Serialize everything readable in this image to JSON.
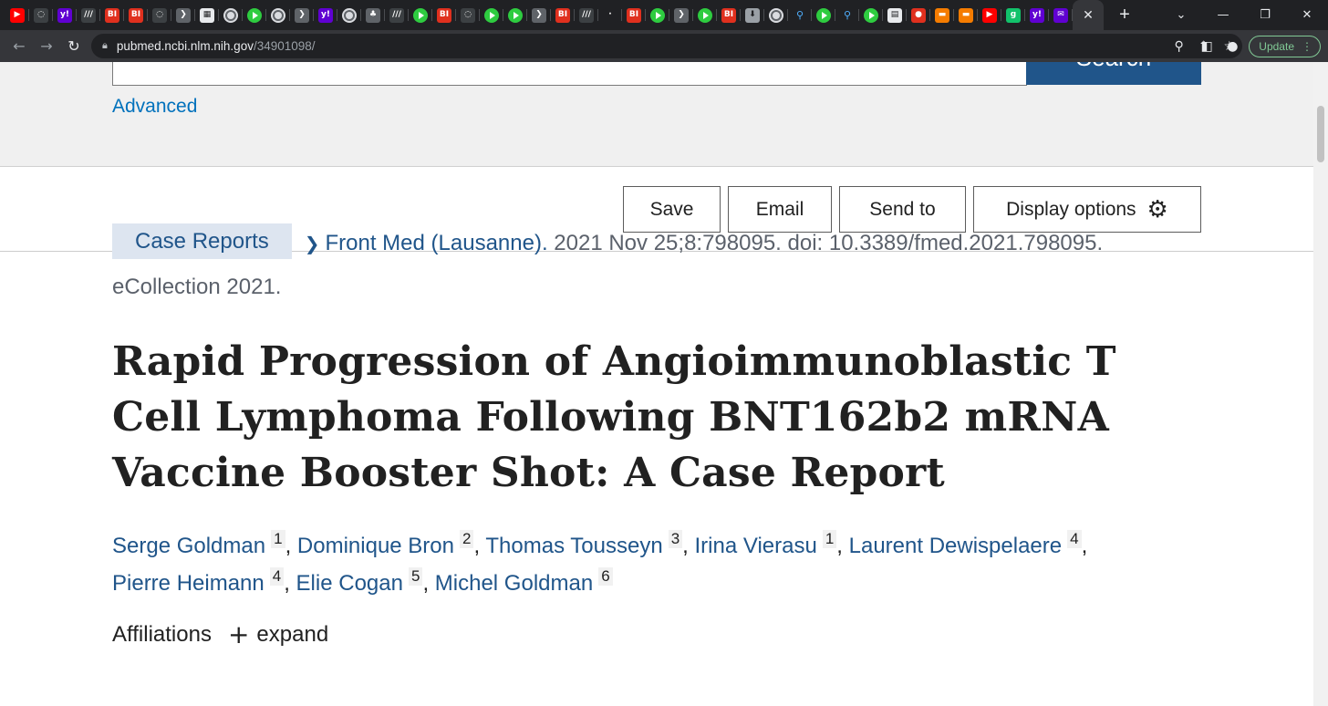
{
  "browser": {
    "tab_icons": [
      {
        "name": "youtube-icon",
        "bg": "#ff0000",
        "glyph": "▶"
      },
      {
        "name": "shield-icon",
        "bg": "#3c4043",
        "glyph": "◌"
      },
      {
        "name": "yahoo-icon",
        "bg": "#6001d2",
        "glyph": "y!"
      },
      {
        "name": "slash-icon",
        "bg": "#3c4043",
        "glyph": "///"
      },
      {
        "name": "bi-icon",
        "bg": "#e0301e",
        "glyph": "BI"
      },
      {
        "name": "bi-icon",
        "bg": "#e0301e",
        "glyph": "BI"
      },
      {
        "name": "shield-icon",
        "bg": "#3c4043",
        "glyph": "◌"
      },
      {
        "name": "forward-icon",
        "bg": "#5f6368",
        "glyph": "❯"
      },
      {
        "name": "grid-icon",
        "bg": "#e8eaed",
        "glyph": "▦"
      },
      {
        "name": "globe-icon",
        "bg": "globe",
        "glyph": ""
      },
      {
        "name": "play-icon",
        "bg": "play",
        "glyph": ""
      },
      {
        "name": "globe-icon",
        "bg": "globe",
        "glyph": ""
      },
      {
        "name": "forward-icon",
        "bg": "#5f6368",
        "glyph": "❯"
      },
      {
        "name": "yahoo-icon",
        "bg": "#6001d2",
        "glyph": "y!"
      },
      {
        "name": "globe-icon",
        "bg": "globe",
        "glyph": ""
      },
      {
        "name": "tree-icon",
        "bg": "#5f6368",
        "glyph": "♣"
      },
      {
        "name": "slash-icon",
        "bg": "#3c4043",
        "glyph": "///"
      },
      {
        "name": "play-icon",
        "bg": "play",
        "glyph": ""
      },
      {
        "name": "bi-icon",
        "bg": "#e0301e",
        "glyph": "BI"
      },
      {
        "name": "shield-icon",
        "bg": "#3c4043",
        "glyph": "◌"
      },
      {
        "name": "play-icon",
        "bg": "play",
        "glyph": ""
      },
      {
        "name": "play-icon",
        "bg": "play",
        "glyph": ""
      },
      {
        "name": "forward-icon",
        "bg": "#5f6368",
        "glyph": "❯"
      },
      {
        "name": "bi-icon",
        "bg": "#e0301e",
        "glyph": "BI"
      },
      {
        "name": "slash-icon",
        "bg": "#3c4043",
        "glyph": "///"
      },
      {
        "name": "dot-icon",
        "bg": "#202124",
        "glyph": "·"
      },
      {
        "name": "bi-icon",
        "bg": "#e0301e",
        "glyph": "BI"
      },
      {
        "name": "play-icon",
        "bg": "play",
        "glyph": ""
      },
      {
        "name": "forward-icon",
        "bg": "#5f6368",
        "glyph": "❯"
      },
      {
        "name": "play-icon",
        "bg": "play",
        "glyph": ""
      },
      {
        "name": "bi-icon",
        "bg": "#e0301e",
        "glyph": "BI"
      },
      {
        "name": "download-icon",
        "bg": "#9aa0a6",
        "glyph": "⬇"
      },
      {
        "name": "globe-icon",
        "bg": "globe",
        "glyph": ""
      },
      {
        "name": "search-icon",
        "bg": "search",
        "glyph": "⚲"
      },
      {
        "name": "play-icon",
        "bg": "play",
        "glyph": ""
      },
      {
        "name": "search-icon",
        "bg": "search",
        "glyph": "⚲"
      },
      {
        "name": "play-icon",
        "bg": "play",
        "glyph": ""
      },
      {
        "name": "news-icon",
        "bg": "#e8eaed",
        "glyph": "▤"
      },
      {
        "name": "mic-icon",
        "bg": "#e0301e",
        "glyph": "●"
      },
      {
        "name": "bookmark-icon",
        "bg": "#f57c00",
        "glyph": "▬"
      },
      {
        "name": "bookmark-icon",
        "bg": "#f57c00",
        "glyph": "▬"
      },
      {
        "name": "youtube-icon",
        "bg": "#ff0000",
        "glyph": "▶"
      },
      {
        "name": "g-icon",
        "bg": "#12c26b",
        "glyph": "g"
      },
      {
        "name": "yahoo-icon",
        "bg": "#6001d2",
        "glyph": "y!"
      },
      {
        "name": "mail-icon",
        "bg": "#6001d2",
        "glyph": "✉"
      }
    ],
    "active_tab_close": "✕",
    "new_tab": "+",
    "window_controls": {
      "menu": "⌄",
      "minimize": "—",
      "maximize": "❐",
      "close": "✕"
    },
    "url_host": "pubmed.ncbi.nlm.nih.gov",
    "url_path": "/34901098/",
    "update_label": "Update"
  },
  "search": {
    "button_label": "Search",
    "advanced_label": "Advanced"
  },
  "actions": {
    "save": "Save",
    "email": "Email",
    "send_to": "Send to",
    "display_options": "Display options"
  },
  "article": {
    "type_badge": "Case Reports",
    "journal": "Front Med (Lausanne).",
    "citation_rest": " 2021 Nov 25;8:798095. doi: 10.3389/fmed.2021.798095. eCollection 2021.",
    "title": "Rapid Progression of Angioimmunoblastic T Cell Lymphoma Following BNT162b2 mRNA Vaccine Booster Shot: A Case Report",
    "authors": [
      {
        "name": "Serge Goldman",
        "aff": "1"
      },
      {
        "name": "Dominique Bron",
        "aff": "2"
      },
      {
        "name": "Thomas Tousseyn",
        "aff": "3"
      },
      {
        "name": "Irina Vierasu",
        "aff": "1"
      },
      {
        "name": "Laurent Dewispelaere",
        "aff": "4"
      },
      {
        "name": "Pierre Heimann",
        "aff": "4"
      },
      {
        "name": "Elie Cogan",
        "aff": "5"
      },
      {
        "name": "Michel Goldman",
        "aff": "6"
      }
    ],
    "affiliations_label": "Affiliations",
    "expand_label": "expand"
  }
}
